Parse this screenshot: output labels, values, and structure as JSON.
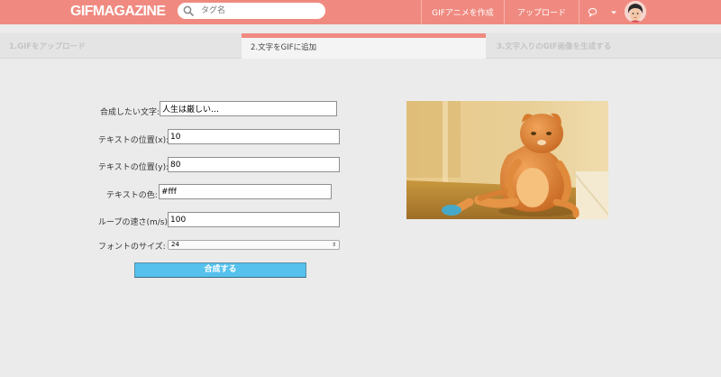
{
  "header": {
    "logo": "GIFMAGAZINE",
    "search_placeholder": "タグ名",
    "nav_create": "GIFアニメを作成",
    "nav_upload": "アップロード"
  },
  "steps": [
    {
      "label": "1.GIFをアップロード",
      "state": "done"
    },
    {
      "label": "2.文字をGIFに追加",
      "state": "active"
    },
    {
      "label": "3.文字入りのGIF画像を生成する",
      "state": "upcoming"
    }
  ],
  "form": {
    "text_label": "合成したい文字:",
    "text_value": "人生は厳しい…",
    "pos_x_label": "テキストの位置(x):",
    "pos_x_value": "10",
    "pos_y_label": "テキストの位置(y):",
    "pos_y_value": "80",
    "color_label": "テキストの色:",
    "color_value": "#fff",
    "speed_label": "ループの速さ(m/s):",
    "speed_value": "100",
    "font_size_label": "フォントのサイズ:",
    "font_size_value": "24",
    "submit_label": "合成する"
  },
  "colors": {
    "header_bg": "#f08a80",
    "page_bg": "#ebebeb",
    "submit_bg": "#55c1ec"
  },
  "icons": [
    "search-icon",
    "chat-icon",
    "menu-caret-icon"
  ]
}
